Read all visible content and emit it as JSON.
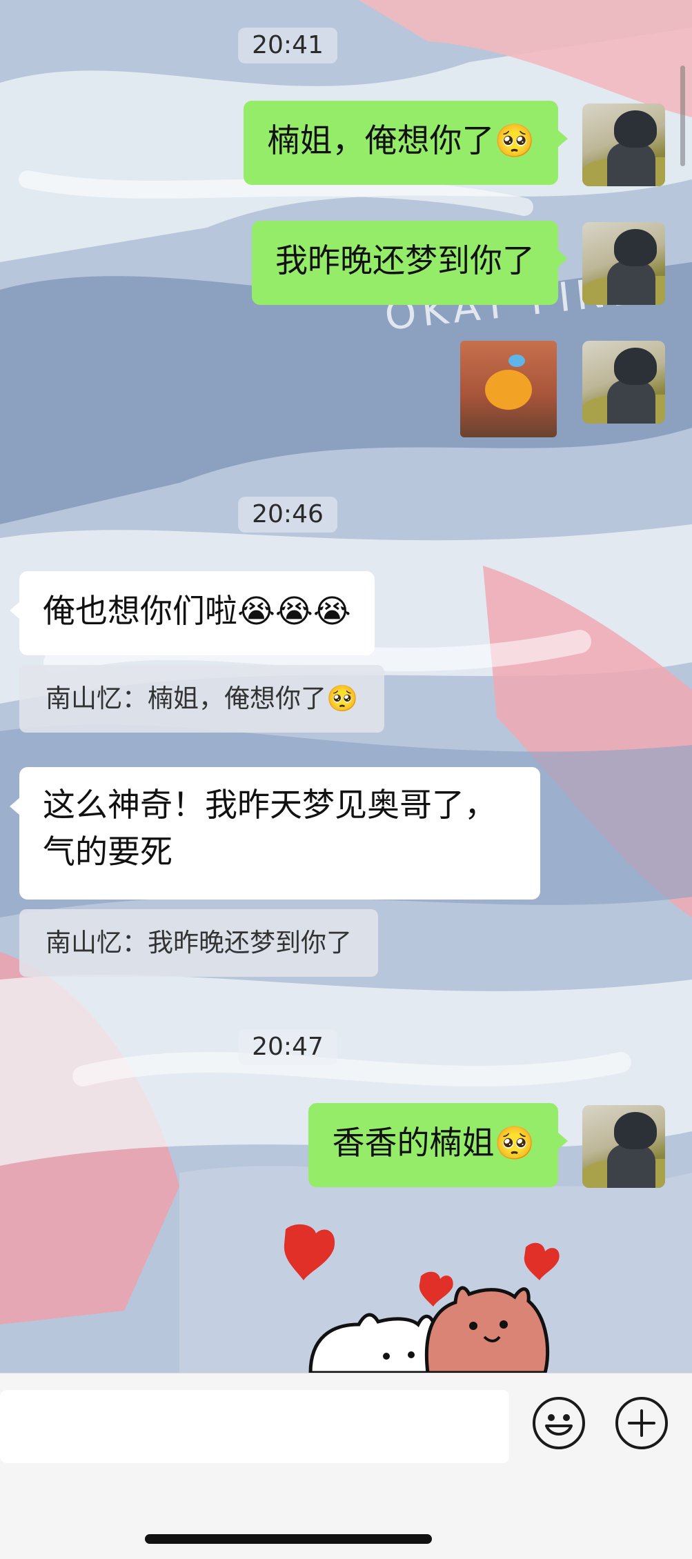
{
  "timestamps": {
    "t1": "20:41",
    "t2": "20:46",
    "t3": "20:47"
  },
  "messages": {
    "me1": "楠姐，俺想你了🥺",
    "me2": "我昨晚还梦到你了",
    "other1": "俺也想你们啦😭😭😭",
    "quote1": "南山忆：楠姐，俺想你了🥺",
    "other2": "这么神奇！我昨天梦见奥哥了，气的要死",
    "quote2": "南山忆：我昨晚还梦到你了",
    "me3": "香香的楠姐🥺"
  },
  "wallpaper": {
    "overlay_text": "OKAY FINE."
  },
  "colors": {
    "my_bubble": "#95ec69",
    "other_bubble": "#ffffff",
    "input_bar": "#f5f5f5"
  },
  "icons": {
    "emoji_button": "smiley-face-icon",
    "more_button": "plus-circle-icon"
  }
}
